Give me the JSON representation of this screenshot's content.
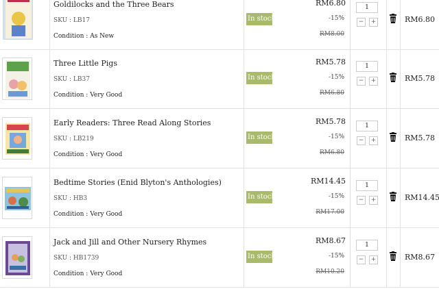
{
  "cart": {
    "stock_color": "#a9bb6a",
    "items": [
      {
        "title": "Goldilocks and the Three Bears",
        "sku": "SKU : LB17",
        "condition": "Condition : As New",
        "stock": "In stock",
        "price": "RM6.80",
        "discount": "-15%",
        "old_price": "RM8.00",
        "qty": "1",
        "subtotal": "RM6.80"
      },
      {
        "title": "Three Little Pigs",
        "sku": "SKU : LB37",
        "condition": "Condition : Very Good",
        "stock": "In stock",
        "price": "RM5.78",
        "discount": "-15%",
        "old_price": "RM6.80",
        "qty": "1",
        "subtotal": "RM5.78"
      },
      {
        "title": "Early Readers: Three Read Along Stories",
        "sku": "SKU : LB219",
        "condition": "Condition : Very Good",
        "stock": "In stock",
        "price": "RM5.78",
        "discount": "-15%",
        "old_price": "RM6.80",
        "qty": "1",
        "subtotal": "RM5.78"
      },
      {
        "title": "Bedtime Stories (Enid Blyton's Anthologies)",
        "sku": "SKU : HB3",
        "condition": "Condition : Very Good",
        "stock": "In stock",
        "price": "RM14.45",
        "discount": "-15%",
        "old_price": "RM17.00",
        "qty": "1",
        "subtotal": "RM14.45"
      },
      {
        "title": "Jack and Jill and Other Nursery Rhymes",
        "sku": "SKU : HB1739",
        "condition": "Condition : Very Good",
        "stock": "In stock",
        "price": "RM8.67",
        "discount": "-15%",
        "old_price": "RM10.20",
        "qty": "1",
        "subtotal": "RM8.67"
      }
    ],
    "controls": {
      "minus": "−",
      "plus": "+",
      "trash_icon": "trash-icon"
    }
  }
}
